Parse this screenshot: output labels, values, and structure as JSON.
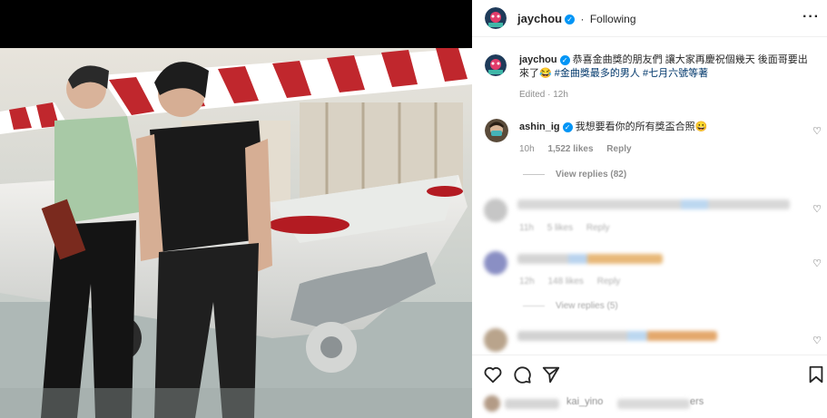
{
  "post": {
    "username": "jaychou",
    "following_label": "Following",
    "more_icon": "more-horizontal-icon"
  },
  "caption": {
    "username": "jaychou",
    "text_line1": "恭喜金曲獎的朋友們 讓大家再慶祝個幾天 後面哥要出",
    "text_line2_prefix": "來了😂",
    "hashtag1": "#金曲獎最多的男人",
    "hashtag2": "#七月六號等著",
    "edited": "Edited · 12h"
  },
  "comments": [
    {
      "username": "ashin_ig",
      "text": "我想要看你的所有獎盃合照😀",
      "time": "10h",
      "likes": "1,522 likes",
      "reply": "Reply",
      "view_replies": "View replies (82)"
    },
    {
      "time": "11h",
      "likes": "5 likes",
      "reply": "Reply"
    },
    {
      "time": "12h",
      "likes": "148 likes",
      "reply": "Reply",
      "view_replies": "View replies (5)"
    }
  ],
  "likes_line": {
    "partial_user": "kai_yino",
    "tail": "ers"
  },
  "colors": {
    "verified": "#0095f6",
    "hashtag": "#00376b",
    "muted": "#8e8e8e"
  }
}
